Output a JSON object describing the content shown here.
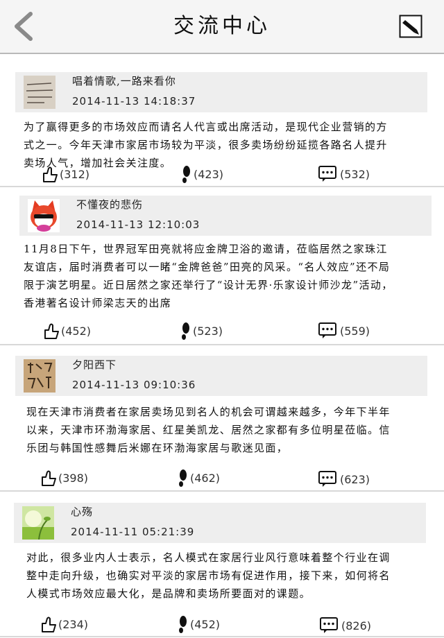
{
  "header": {
    "title": "交流中心",
    "back_icon": "chevron-left-icon",
    "compose_icon": "edit-icon"
  },
  "posts": [
    {
      "name": "唱着情歌,一路来看你",
      "time": "2014-11-13 14:18:37",
      "content": "为了赢得更多的市场效应而请名人代言或出席活动，是现代企业营销的方式之一。今年天津市家居市场较为平淡，很多卖场纷纷延揽各路名人提升卖场人气，增加社会关注度。",
      "likes": "(312)",
      "views": "(423)",
      "comments": "(532)"
    },
    {
      "name": "不懂夜的悲伤",
      "time": "2014-11-13 12:10:03",
      "content": "11月8日下午，世界冠军田亮就将应金牌卫浴的邀请，莅临居然之家珠江友谊店，届时消费者可以一睹“金牌爸爸”田亮的风采。“名人效应”还不局限于演艺明星。近日居然之家还举行了“设计无界·乐家设计师沙龙”活动，香港著名设计师梁志天的出席",
      "likes": "(452)",
      "views": "(523)",
      "comments": "(559)"
    },
    {
      "name": "夕阳西下",
      "time": "2014-11-13 09:10:36",
      "content": "现在天津市消费者在家居卖场见到名人的机会可谓越来越多，今年下半年以来，天津市环渤海家居、红星美凯龙、居然之家都有多位明星莅临。信乐团与韩国性感舞后米娜在环渤海家居与歌迷见面，",
      "likes": "(398)",
      "views": "(462)",
      "comments": "(623)"
    },
    {
      "name": "心殇",
      "time": "2014-11-11 05:21:39",
      "content": "对此，很多业内人士表示，名人模式在家居行业风行意味着整个行业在调整中走向升级，也确实对平淡的家居市场有促进作用，接下来，如何将名人模式市场效应最大化，是品牌和卖场所要面对的课题。",
      "likes": "(234)",
      "views": "(452)",
      "comments": "(826)"
    }
  ]
}
